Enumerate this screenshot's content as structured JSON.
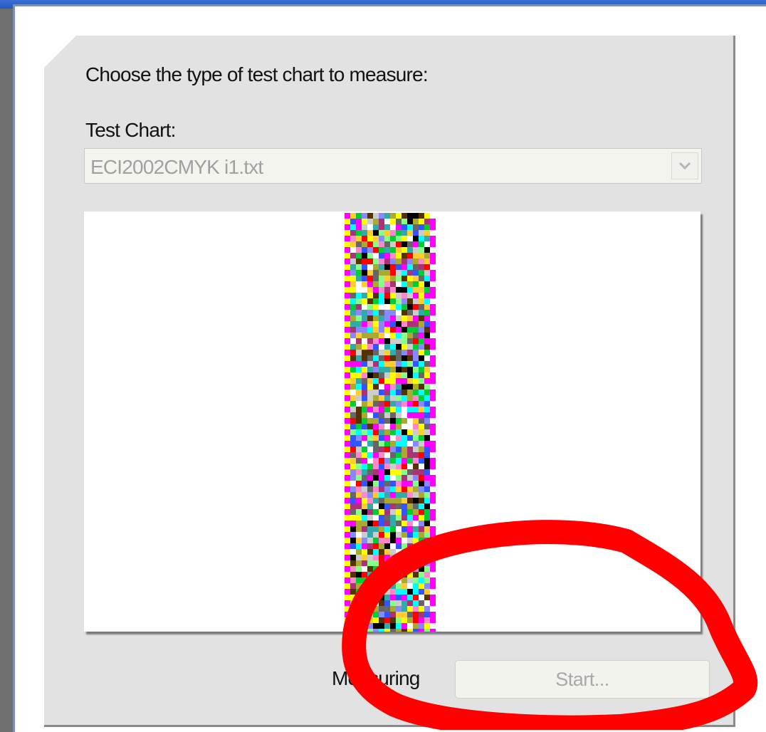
{
  "dialog": {
    "instruction": "Choose the type of test chart to measure:",
    "test_chart_label": "Test Chart:",
    "test_chart_value": "ECI2002CMYK i1.txt",
    "status_text": "Measuring",
    "start_button": "Start..."
  },
  "icons": {
    "dropdown": "chevron-down-icon"
  },
  "colors": {
    "panel": "#e2e2e2",
    "annotation": "#ff0000",
    "disabled_text": "#a0a0a0"
  },
  "test_chart_patch_palette": [
    "#ff00ff",
    "#ffff00",
    "#00ffff",
    "#000000",
    "#ff0000",
    "#00cc33",
    "#3355ff",
    "#ff88cc",
    "#88ff88",
    "#8888ff",
    "#ffcc33",
    "#666666",
    "#cccccc",
    "#ffffff",
    "#aa3377",
    "#33aaaa",
    "#aaaa33",
    "#553300"
  ]
}
